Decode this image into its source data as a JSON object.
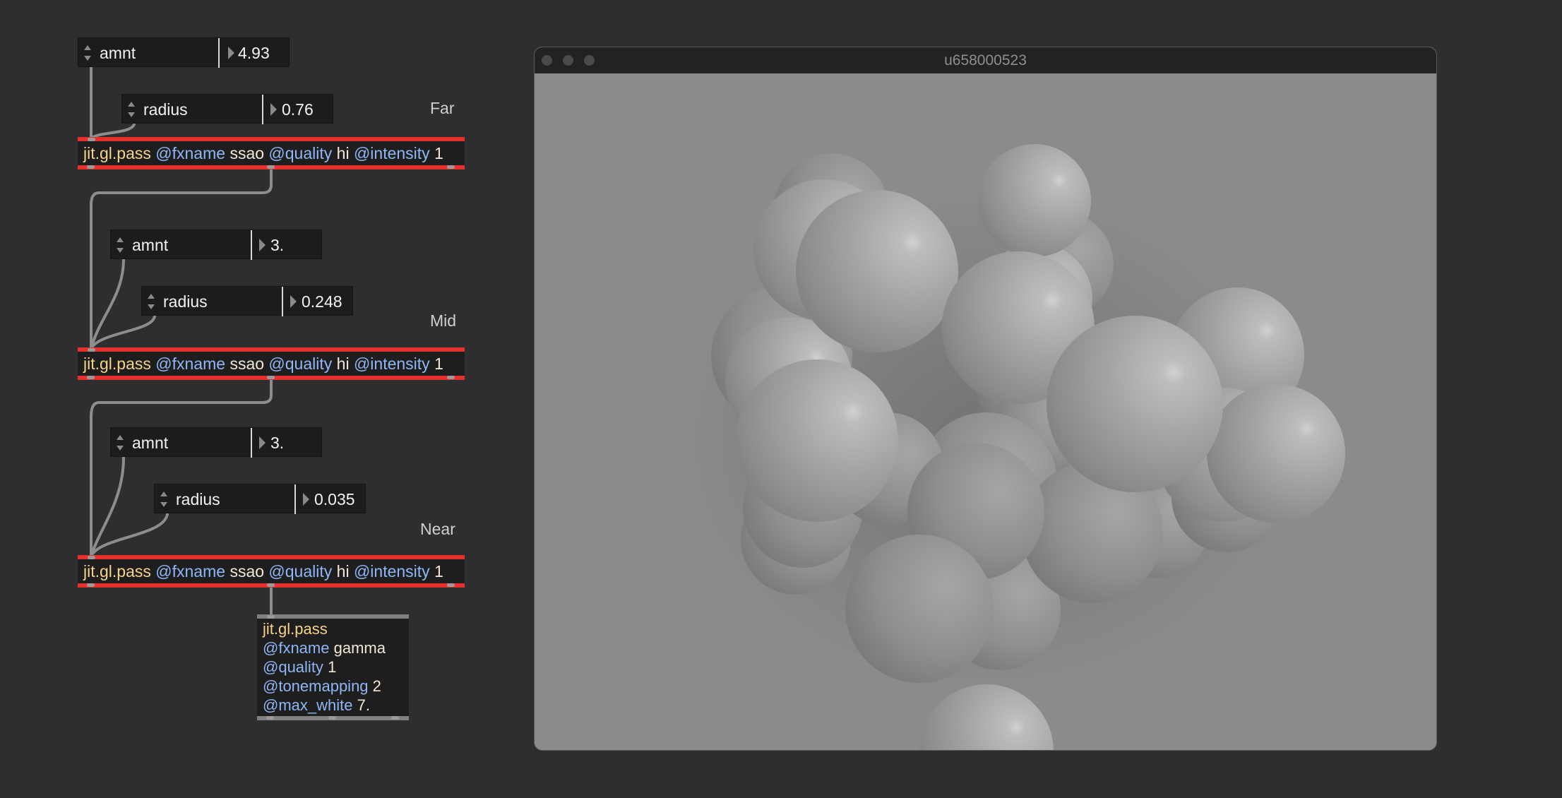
{
  "patch": {
    "groups": [
      {
        "label": "Far",
        "amnt": {
          "name": "amnt",
          "value": "4.93"
        },
        "radius": {
          "name": "radius",
          "value": "0.76"
        },
        "pass": {
          "class": "jit.gl.pass",
          "a1": "@fxname",
          "v1": "ssao",
          "a2": "@quality",
          "v2": "hi",
          "a3": "@intensity",
          "v3": "1"
        }
      },
      {
        "label": "Mid",
        "amnt": {
          "name": "amnt",
          "value": "3."
        },
        "radius": {
          "name": "radius",
          "value": "0.248"
        },
        "pass": {
          "class": "jit.gl.pass",
          "a1": "@fxname",
          "v1": "ssao",
          "a2": "@quality",
          "v2": "hi",
          "a3": "@intensity",
          "v3": "1"
        }
      },
      {
        "label": "Near",
        "amnt": {
          "name": "amnt",
          "value": "3."
        },
        "radius": {
          "name": "radius",
          "value": "0.035"
        },
        "pass": {
          "class": "jit.gl.pass",
          "a1": "@fxname",
          "v1": "ssao",
          "a2": "@quality",
          "v2": "hi",
          "a3": "@intensity",
          "v3": "1"
        }
      }
    ],
    "gamma": {
      "class": "jit.gl.pass",
      "a1": "@fxname",
      "v1": "gamma",
      "a2": "@quality",
      "v2": "1",
      "a3": "@tonemapping",
      "v3": "2",
      "a4": "@max_white",
      "v4": "7."
    }
  },
  "window": {
    "title": "u658000523"
  },
  "colors": {
    "background": "#2e2e2e",
    "object_border": "#e4312b",
    "class_text": "#f5d38a",
    "attribute_text": "#8fb6f5",
    "argument_text": "#f4e6d6"
  }
}
